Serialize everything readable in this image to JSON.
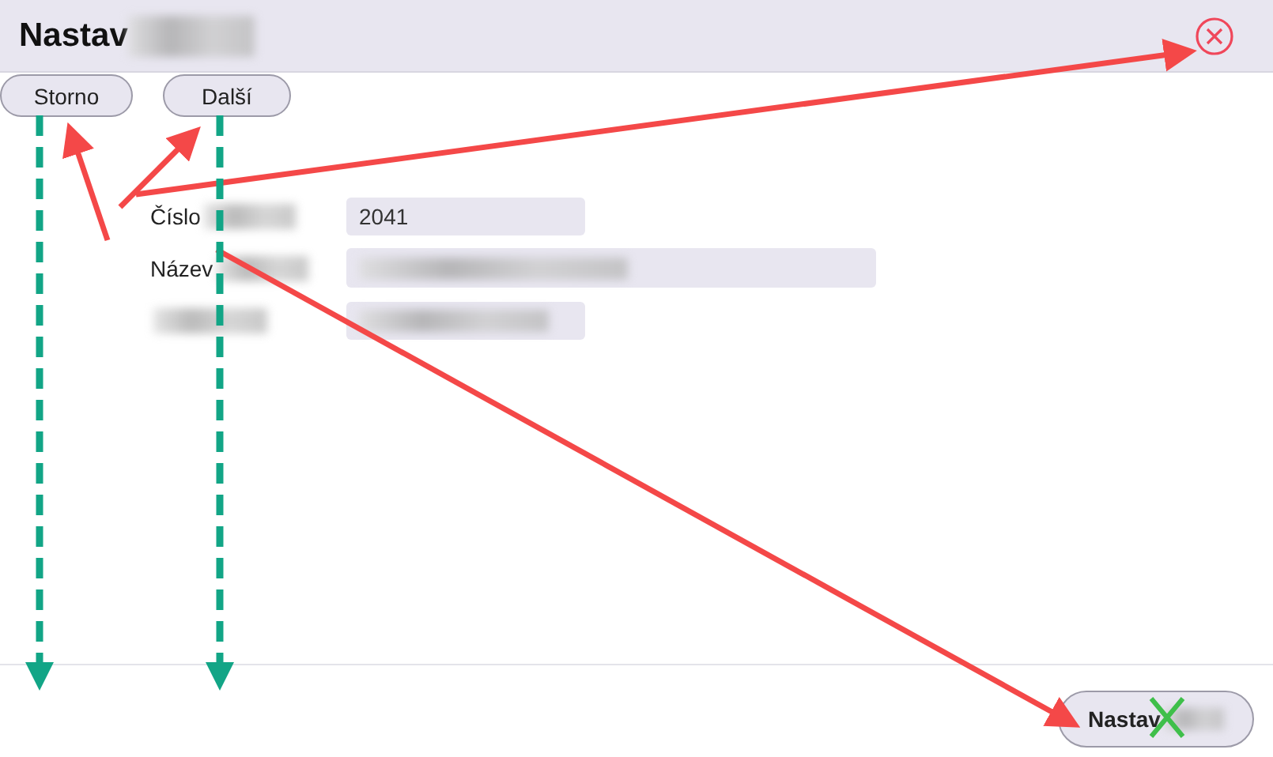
{
  "dialog": {
    "title": "Nastav",
    "title_redacted": true
  },
  "toolbar": {
    "buttons": [
      "Storno",
      "Další"
    ]
  },
  "fields": [
    {
      "label": "Číslo",
      "label_redacted": true,
      "value": "2041",
      "value_redacted": false,
      "wide": false
    },
    {
      "label": "Název",
      "label_redacted": true,
      "value_redacted": true,
      "wide": true
    },
    {
      "label_redacted": true,
      "value_redacted": true,
      "wide": false
    }
  ],
  "footer": {
    "button": "Nastav",
    "button_redacted": true
  }
}
